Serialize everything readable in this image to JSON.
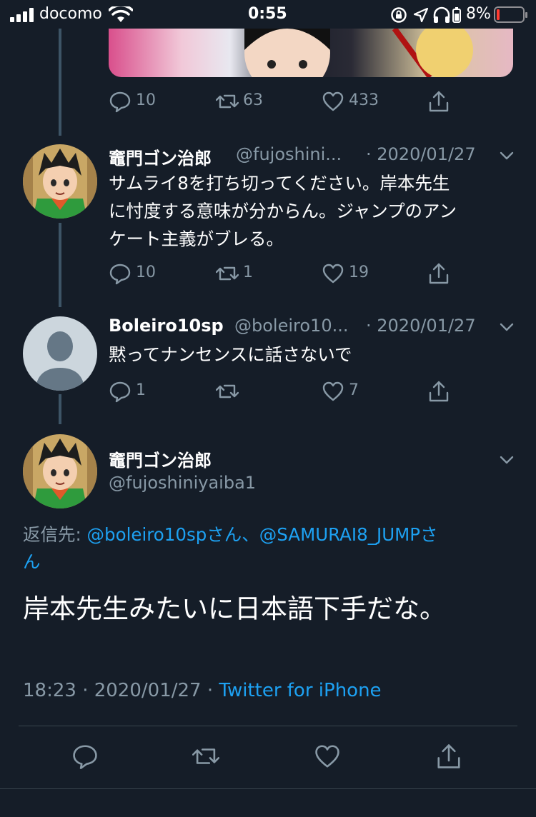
{
  "status_bar": {
    "carrier": "docomo",
    "time": "0:55",
    "battery": "8%"
  },
  "tweets": [
    {
      "actions": {
        "replies": "10",
        "retweets": "63",
        "likes": "433"
      }
    },
    {
      "name": "竈門ゴン治郎",
      "handle": "@fujoshini...",
      "date": "· 2020/01/27",
      "text_lines": [
        "サムライ8を打ち切ってください。岸本先生",
        "に忖度する意味が分からん。ジャンプのアン",
        "ケート主義がブレる。"
      ],
      "actions": {
        "replies": "10",
        "retweets": "1",
        "likes": "19"
      }
    },
    {
      "name": "Boleiro10sp",
      "handle": "@boleiro10...",
      "date": "· 2020/01/27",
      "text": "黙ってナンセンスに話さないで",
      "actions": {
        "replies": "1",
        "retweets": "",
        "likes": "7"
      }
    }
  ],
  "main_tweet": {
    "name": "竈門ゴン治郎",
    "handle": "@fujoshiniyaiba1",
    "reply_to_label": "返信先: ",
    "reply_to_user1": "@boleiro10spさん",
    "reply_to_sep": "、",
    "reply_to_user2": "@SAMURAI8_JUMPさ",
    "reply_to_tail": "ん",
    "text": "岸本先生みたいに日本語下手だな。",
    "time": "18:23 · 2020/01/27 · ",
    "source": "Twitter for iPhone"
  },
  "colors": {
    "background": "#151d28",
    "secondary_text": "#8899a6",
    "link": "#1da1f2",
    "thread_line": "#3d5466",
    "battery_low": "#ff3b30"
  },
  "icons": [
    "signal-icon",
    "wifi-icon",
    "lock-rotation-icon",
    "location-icon",
    "headphones-icon",
    "battery-icon",
    "reply-icon",
    "retweet-icon",
    "like-icon",
    "share-icon",
    "chevron-down-icon"
  ]
}
